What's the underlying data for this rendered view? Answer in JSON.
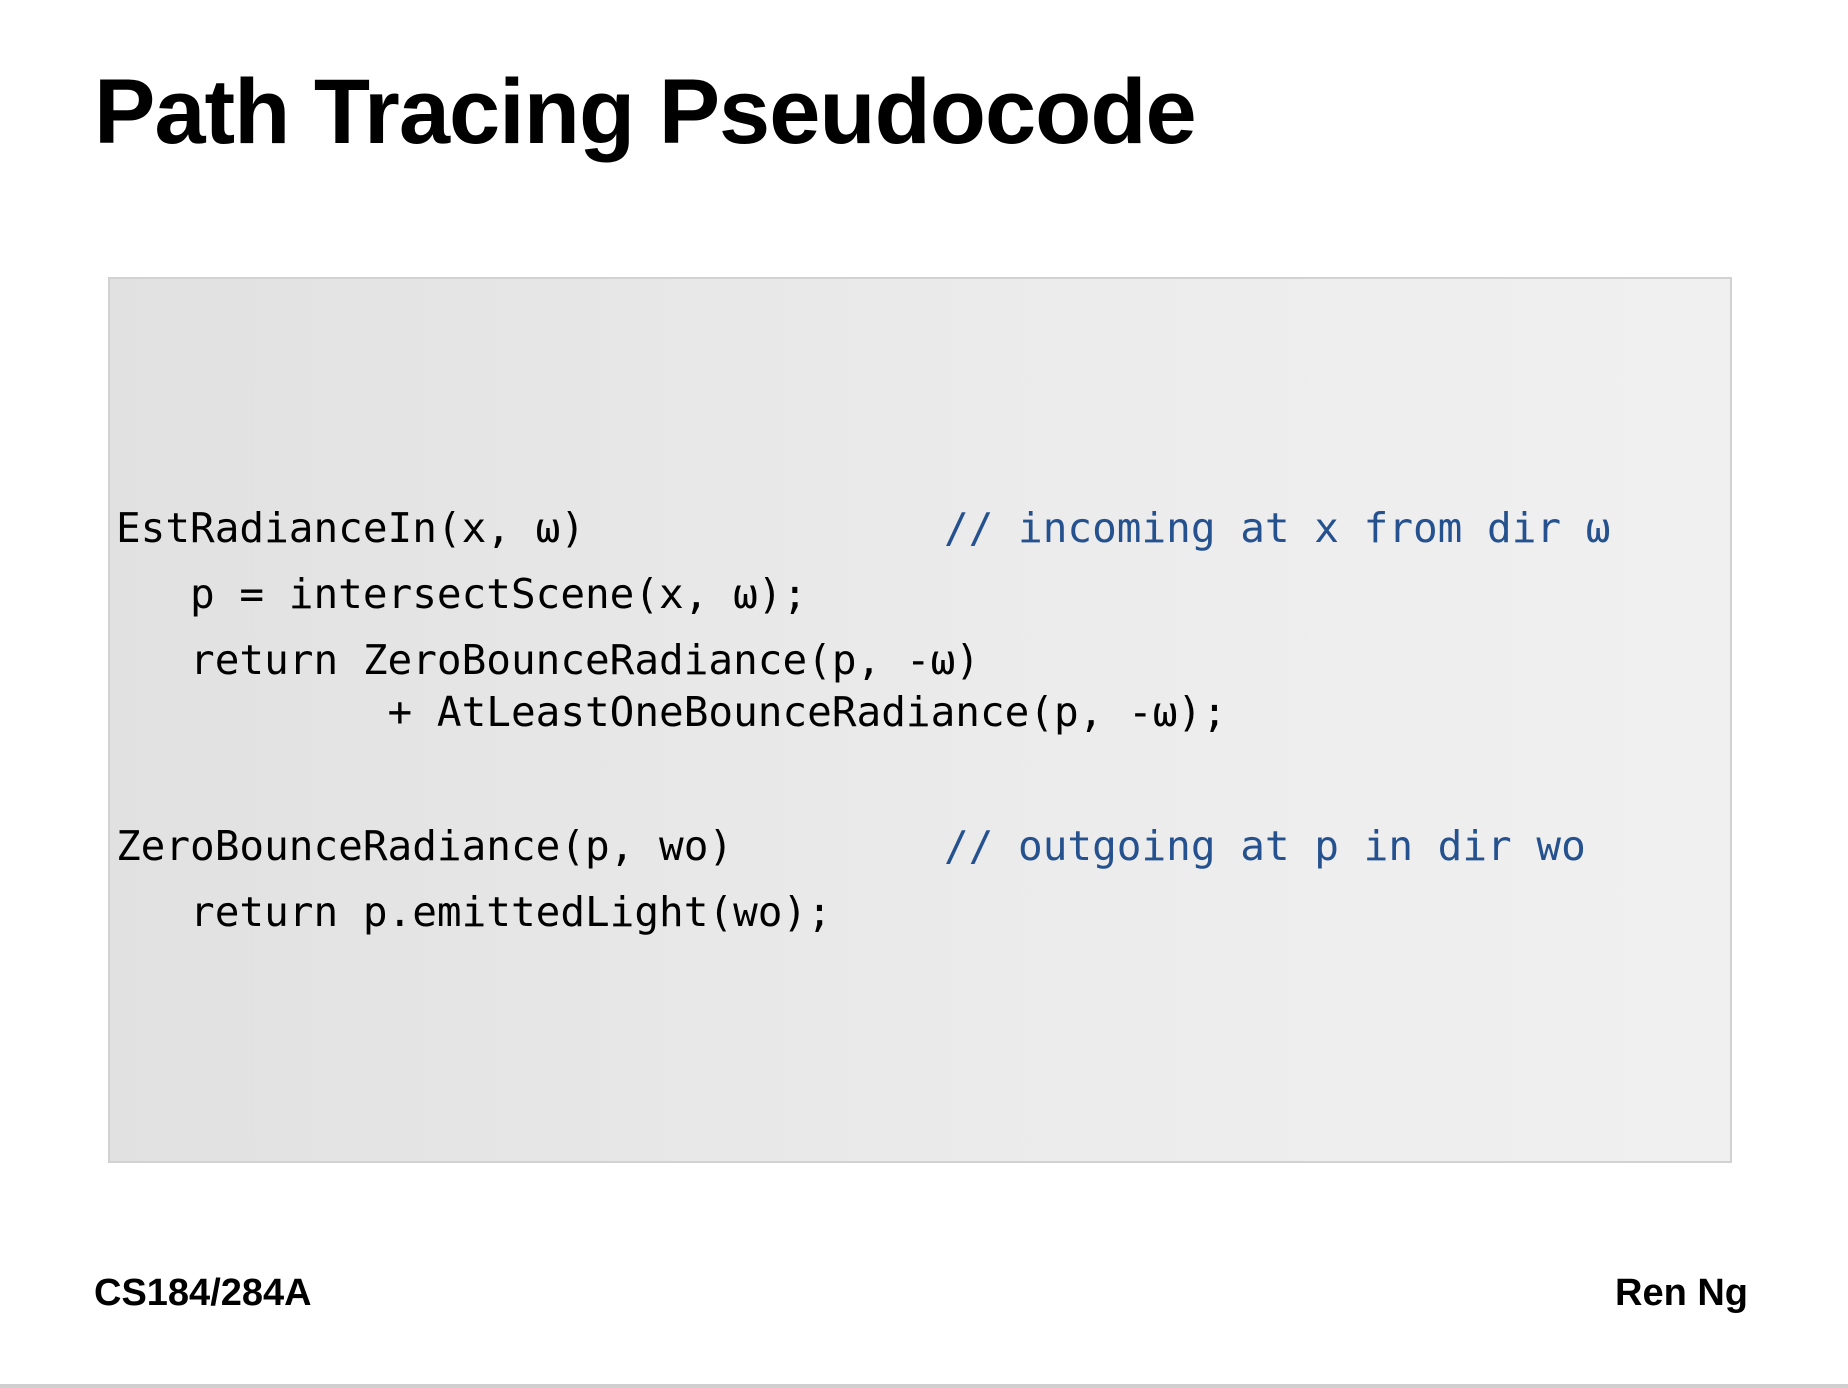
{
  "slide": {
    "title": "Path Tracing Pseudocode",
    "footer_left": "CS184/284A",
    "footer_right": "Ren Ng"
  },
  "code": {
    "lines": [
      "EstRadianceIn(x, ω)",
      "   p = intersectScene(x, ω);",
      "   return ZeroBounceRadiance(p, -ω)",
      "           + AtLeastOneBounceRadiance(p, -ω);",
      "ZeroBounceRadiance(p, wo)",
      "   return p.emittedLight(wo);"
    ],
    "comments": [
      "// incoming at x from dir ω",
      "// outgoing at p in dir wo"
    ]
  },
  "colors": {
    "comment": "#25528f",
    "code_background": "#e6e6e6",
    "text": "#000000"
  }
}
